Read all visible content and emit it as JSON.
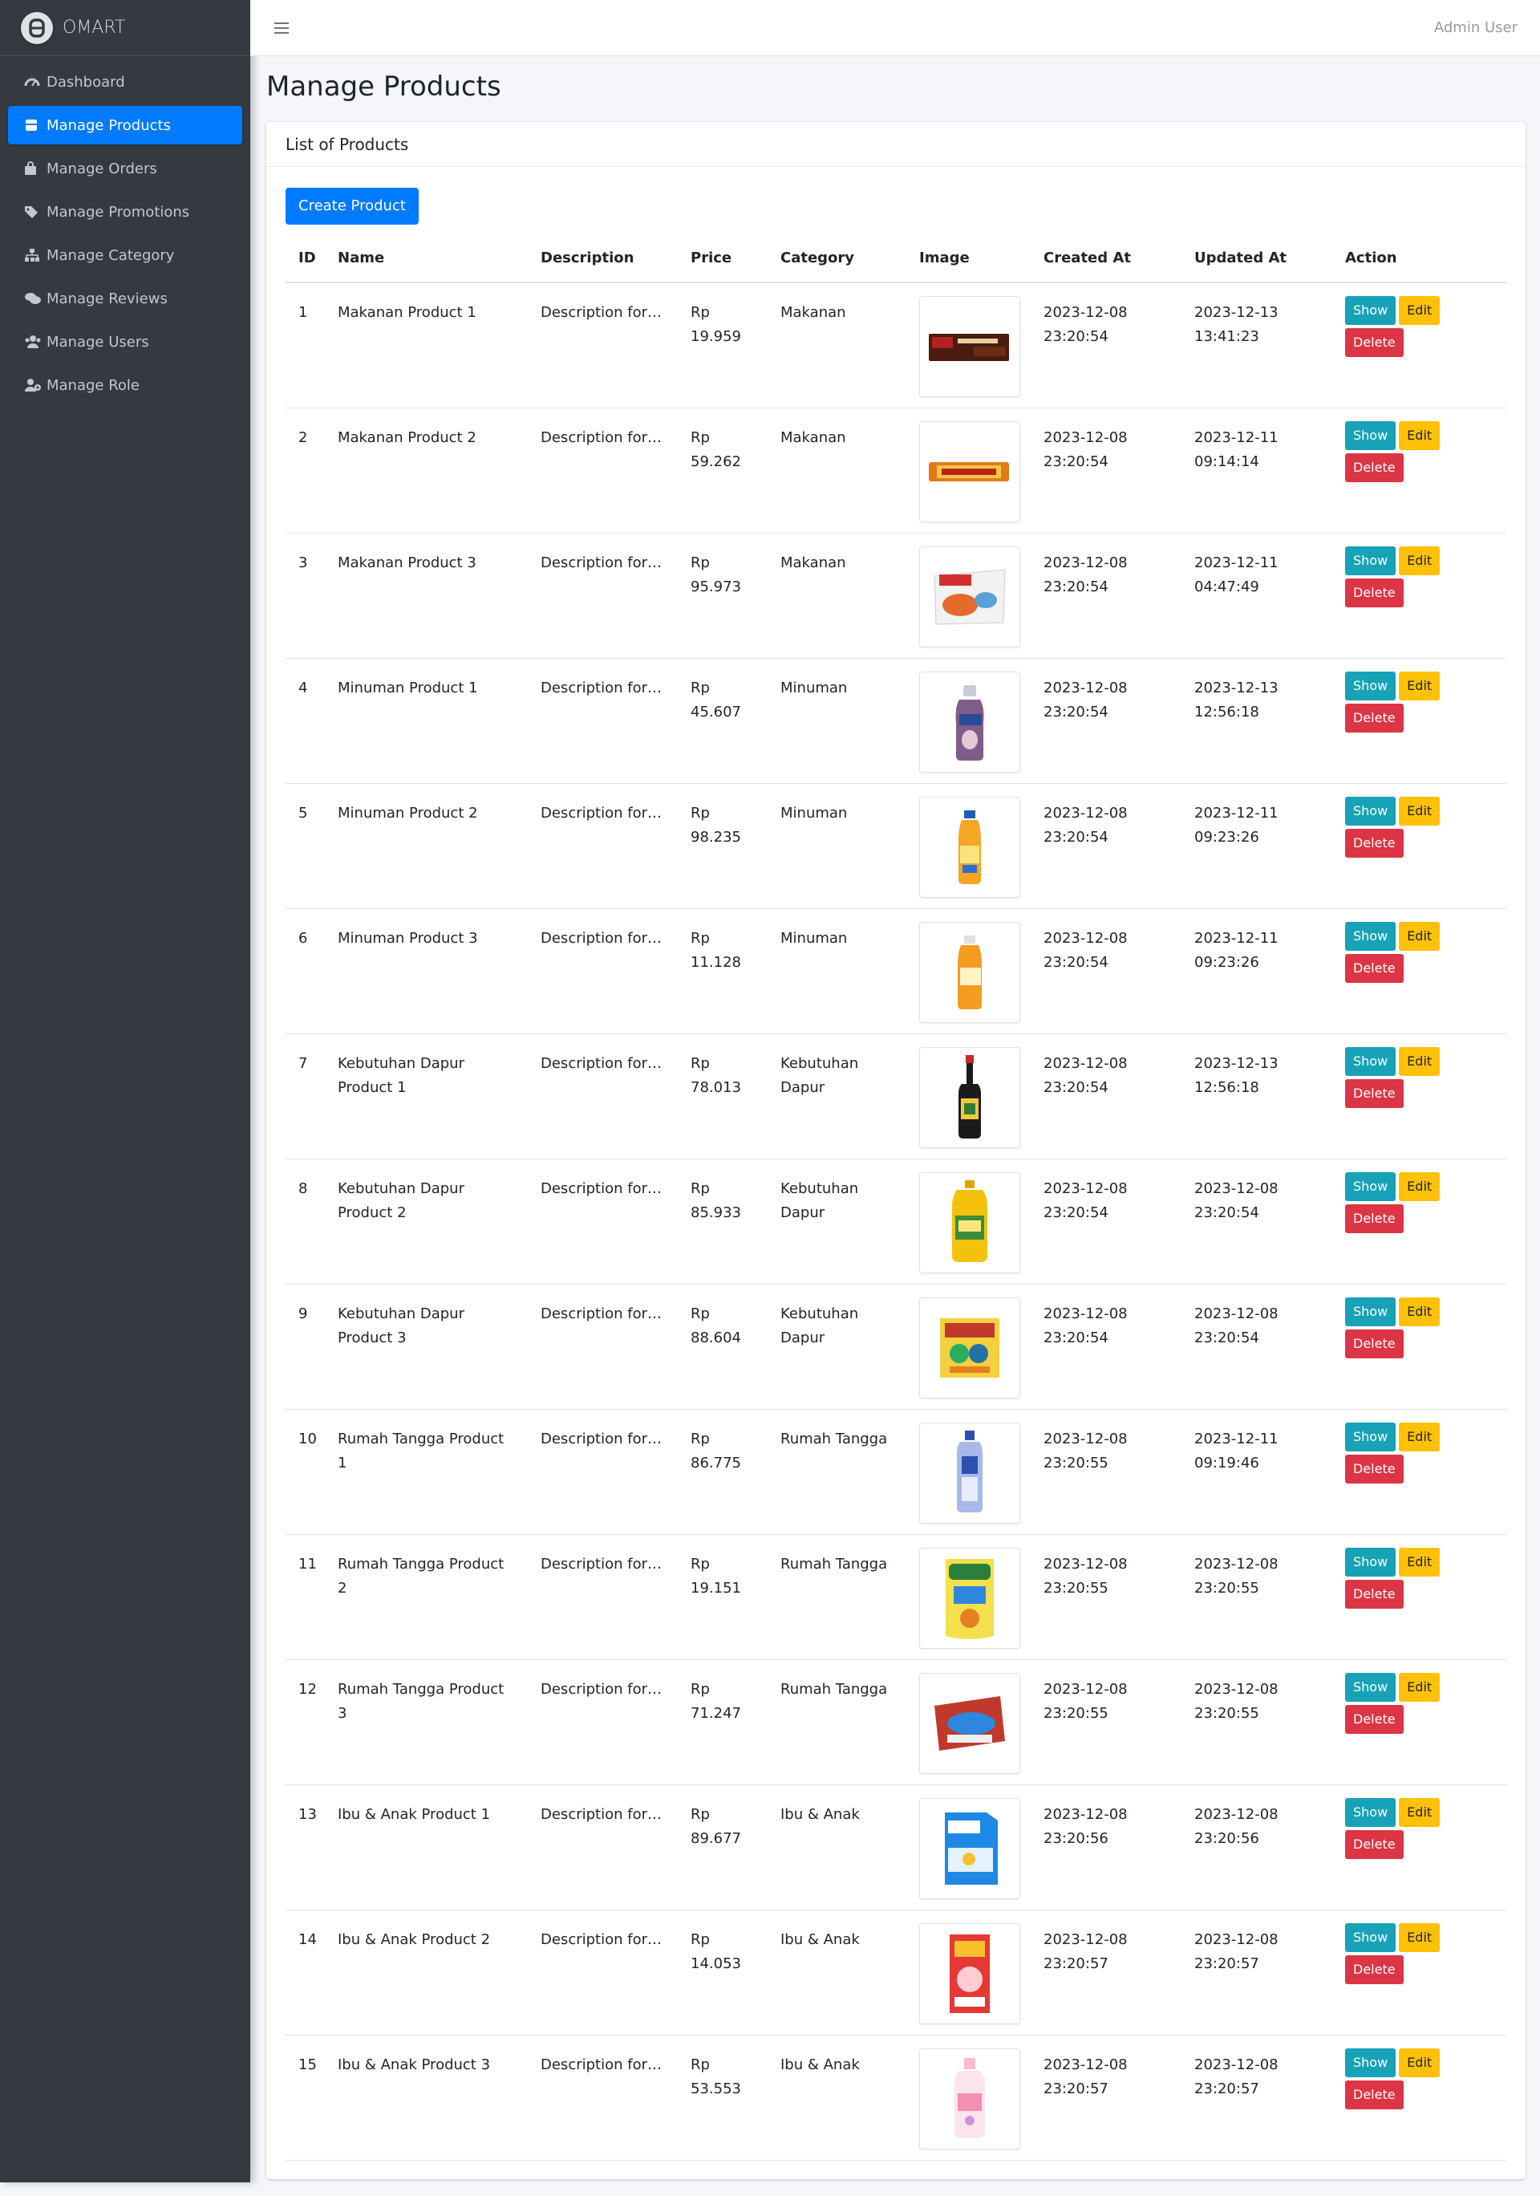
{
  "brand": {
    "name": "OMART"
  },
  "sidebar": {
    "items": [
      {
        "label": "Dashboard",
        "icon": "dashboard-icon"
      },
      {
        "label": "Manage Products",
        "icon": "box-icon",
        "active": true
      },
      {
        "label": "Manage Orders",
        "icon": "shopping-bag-icon"
      },
      {
        "label": "Manage Promotions",
        "icon": "tags-icon"
      },
      {
        "label": "Manage Category",
        "icon": "sitemap-icon"
      },
      {
        "label": "Manage Reviews",
        "icon": "comments-icon"
      },
      {
        "label": "Manage Users",
        "icon": "users-icon"
      },
      {
        "label": "Manage Role",
        "icon": "user-cog-icon"
      }
    ]
  },
  "topbar": {
    "user": "Admin User",
    "menu_icon": "hamburger-icon"
  },
  "page": {
    "title": "Manage Products"
  },
  "card": {
    "title": "List of Products",
    "create_label": "Create Product"
  },
  "table": {
    "headers": [
      "ID",
      "Name",
      "Description",
      "Price",
      "Category",
      "Image",
      "Created At",
      "Updated At",
      "Action"
    ],
    "actions": {
      "show": "Show",
      "edit": "Edit",
      "delete": "Delete"
    },
    "rows": [
      {
        "id": "1",
        "name": "Makanan Product 1",
        "desc": "Description for …",
        "price": "Rp 19.959",
        "category": "Makanan",
        "created": "2023-12-08 23:20:54",
        "updated": "2023-12-13 13:41:23",
        "image": "chocolate-wafer"
      },
      {
        "id": "2",
        "name": "Makanan Product 2",
        "desc": "Description for …",
        "price": "Rp 59.262",
        "category": "Makanan",
        "created": "2023-12-08 23:20:54",
        "updated": "2023-12-11 09:14:14",
        "image": "silverqueen-chocolate"
      },
      {
        "id": "3",
        "name": "Makanan Product 3",
        "desc": "Description for …",
        "price": "Rp 95.973",
        "category": "Makanan",
        "created": "2023-12-08 23:20:54",
        "updated": "2023-12-11 04:47:49",
        "image": "instant-noodle"
      },
      {
        "id": "4",
        "name": "Minuman Product 1",
        "desc": "Description for …",
        "price": "Rp 45.607",
        "category": "Minuman",
        "created": "2023-12-08 23:20:54",
        "updated": "2023-12-13 12:56:18",
        "image": "milk-bottle"
      },
      {
        "id": "5",
        "name": "Minuman Product 2",
        "desc": "Description for …",
        "price": "Rp 98.235",
        "category": "Minuman",
        "created": "2023-12-08 23:20:54",
        "updated": "2023-12-11 09:23:26",
        "image": "orange-drink-bottle"
      },
      {
        "id": "6",
        "name": "Minuman Product 3",
        "desc": "Description for …",
        "price": "Rp 11.128",
        "category": "Minuman",
        "created": "2023-12-08 23:20:54",
        "updated": "2023-12-11 09:23:26",
        "image": "juice-bottle"
      },
      {
        "id": "7",
        "name": "Kebutuhan Dapur Product 1",
        "desc": "Description for …",
        "price": "Rp 78.013",
        "category": "Kebutuhan Dapur",
        "created": "2023-12-08 23:20:54",
        "updated": "2023-12-13 12:56:18",
        "image": "soy-sauce-bottle"
      },
      {
        "id": "8",
        "name": "Kebutuhan Dapur Product 2",
        "desc": "Description for …",
        "price": "Rp 85.933",
        "category": "Kebutuhan Dapur",
        "created": "2023-12-08 23:20:54",
        "updated": "2023-12-08 23:20:54",
        "image": "cooking-oil-bottle"
      },
      {
        "id": "9",
        "name": "Kebutuhan Dapur Product 3",
        "desc": "Description for …",
        "price": "Rp 88.604",
        "category": "Kebutuhan Dapur",
        "created": "2023-12-08 23:20:54",
        "updated": "2023-12-08 23:20:54",
        "image": "seasoning-pack"
      },
      {
        "id": "10",
        "name": "Rumah Tangga Product 1",
        "desc": "Description for …",
        "price": "Rp 86.775",
        "category": "Rumah Tangga",
        "created": "2023-12-08 23:20:55",
        "updated": "2023-12-11 09:19:46",
        "image": "cleaner-bottle"
      },
      {
        "id": "11",
        "name": "Rumah Tangga Product 2",
        "desc": "Description for …",
        "price": "Rp 19.151",
        "category": "Rumah Tangga",
        "created": "2023-12-08 23:20:55",
        "updated": "2023-12-08 23:20:55",
        "image": "dish-soap-pouch"
      },
      {
        "id": "12",
        "name": "Rumah Tangga Product 3",
        "desc": "Description for …",
        "price": "Rp 71.247",
        "category": "Rumah Tangga",
        "created": "2023-12-08 23:20:55",
        "updated": "2023-12-08 23:20:55",
        "image": "tissue-pack"
      },
      {
        "id": "13",
        "name": "Ibu & Anak Product 1",
        "desc": "Description for I…",
        "price": "Rp 89.677",
        "category": "Ibu & Anak",
        "created": "2023-12-08 23:20:56",
        "updated": "2023-12-08 23:20:56",
        "image": "milk-powder-box"
      },
      {
        "id": "14",
        "name": "Ibu & Anak Product 2",
        "desc": "Description for I…",
        "price": "Rp 14.053",
        "category": "Ibu & Anak",
        "created": "2023-12-08 23:20:57",
        "updated": "2023-12-08 23:20:57",
        "image": "baby-cereal-box"
      },
      {
        "id": "15",
        "name": "Ibu & Anak Product 3",
        "desc": "Description for I…",
        "price": "Rp 53.553",
        "category": "Ibu & Anak",
        "created": "2023-12-08 23:20:57",
        "updated": "2023-12-08 23:20:57",
        "image": "baby-lotion-bottle"
      }
    ]
  }
}
